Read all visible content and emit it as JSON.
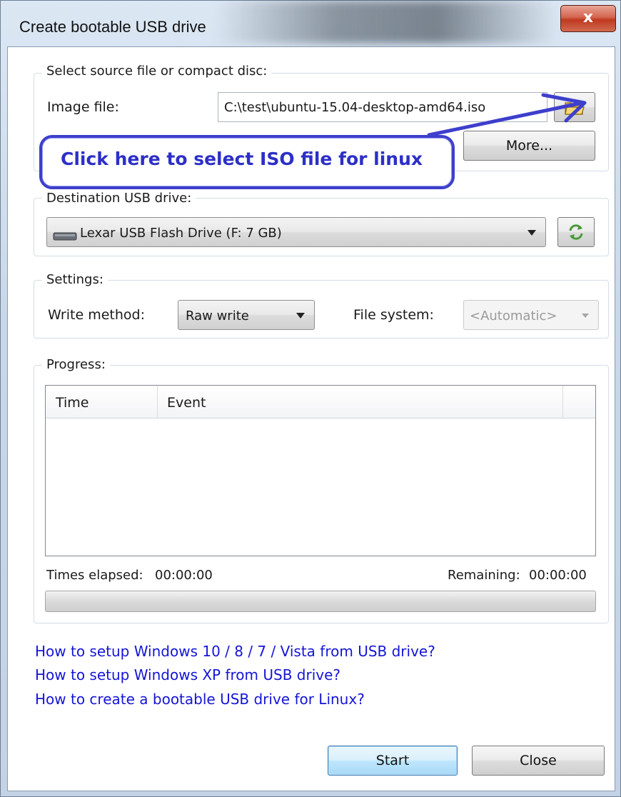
{
  "window": {
    "title": "Create bootable USB drive",
    "close_glyph": "x"
  },
  "source": {
    "group_label": "Select source file or compact disc:",
    "image_label": "Image file:",
    "image_value": "C:\\test\\ubuntu-15.04-desktop-amd64.iso",
    "more_label": "More..."
  },
  "annotation": {
    "text": "Click here to select ISO file for linux"
  },
  "destination": {
    "group_label": "Destination USB drive:",
    "selected": "Lexar USB Flash Drive (F: 7 GB)"
  },
  "settings": {
    "group_label": "Settings:",
    "write_method_label": "Write method:",
    "write_method_value": "Raw write",
    "file_system_label": "File system:",
    "file_system_value": "<Automatic>"
  },
  "progress": {
    "group_label": "Progress:",
    "columns": [
      "Time",
      "Event"
    ],
    "elapsed_label": "Times elapsed:",
    "elapsed_value": "00:00:00",
    "remaining_label": "Remaining:",
    "remaining_value": "00:00:00",
    "fraction": 0
  },
  "links": [
    "How to setup Windows 10 / 8 / 7 / Vista from USB drive?",
    "How to setup Windows XP from USB drive?",
    "How to create a bootable USB drive for Linux?"
  ],
  "buttons": {
    "start": "Start",
    "close": "Close"
  },
  "colors": {
    "link": "#1515d6",
    "annotation": "#3e3fcc"
  },
  "icons": {
    "browse": "folder-open-icon",
    "refresh": "refresh-icon",
    "drive": "usb-drive-icon"
  }
}
